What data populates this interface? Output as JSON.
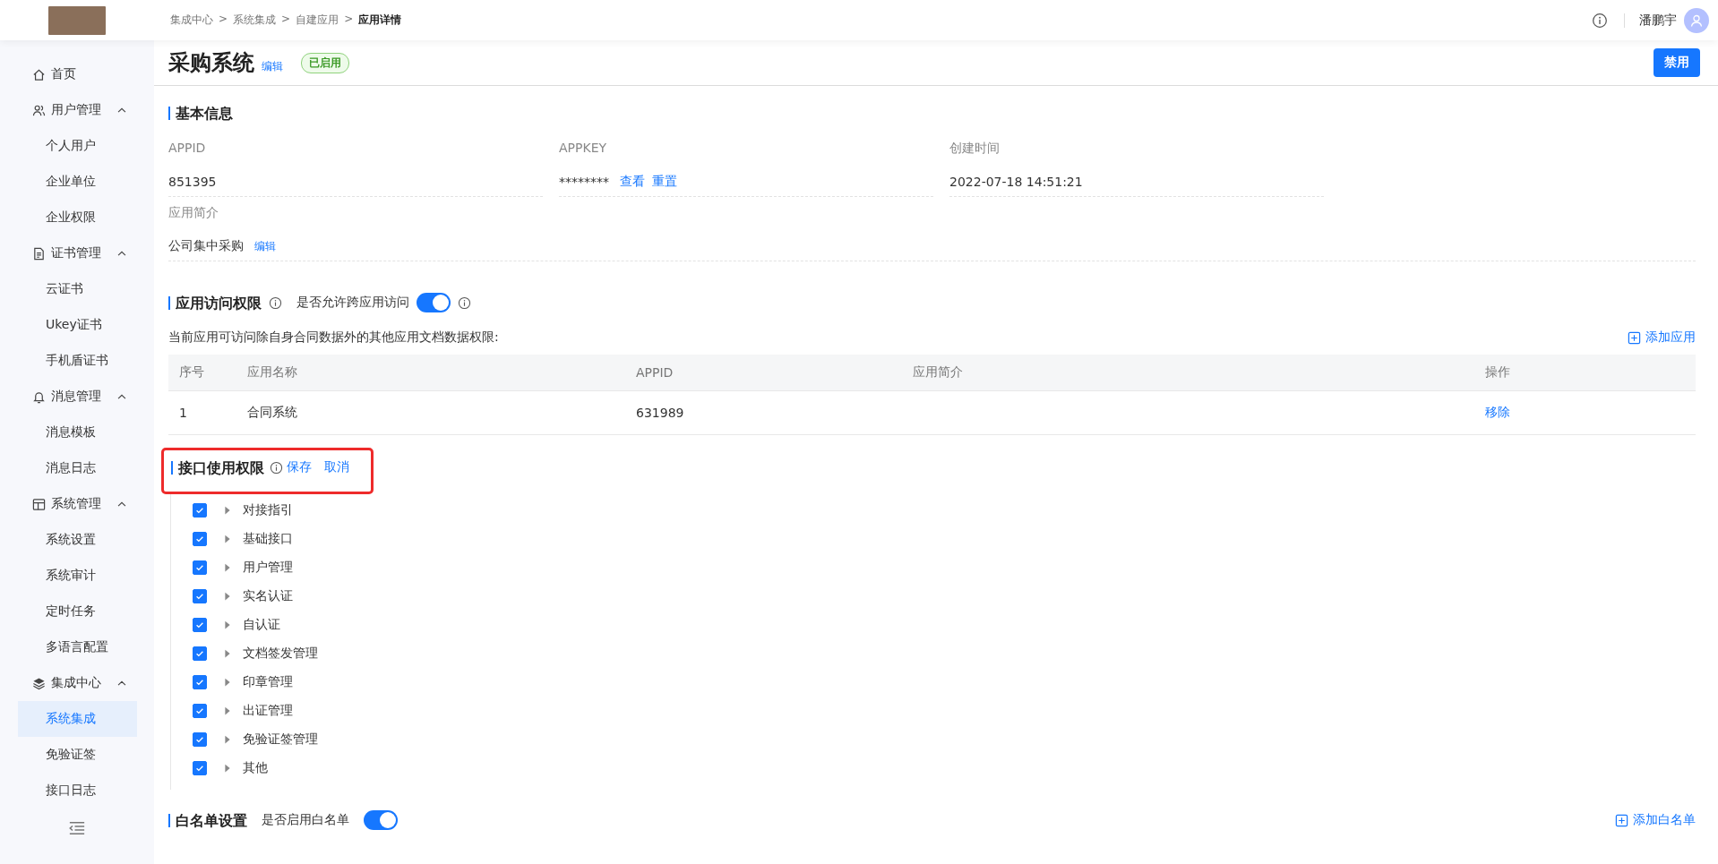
{
  "topbar": {
    "breadcrumb": [
      {
        "label": "集成中心",
        "separator": ">",
        "current": false
      },
      {
        "label": "系统集成",
        "separator": ">",
        "current": false
      },
      {
        "label": "自建应用",
        "separator": ">",
        "current": false
      },
      {
        "label": "应用详情",
        "current": true
      }
    ],
    "user": "潘鹏宇"
  },
  "sidebar": {
    "items": [
      {
        "label": "首页",
        "selected": false
      },
      {
        "label": "用户管理",
        "selected": false,
        "expanded": true,
        "children": [
          {
            "label": "个人用户",
            "selected": false
          },
          {
            "label": "企业单位",
            "selected": false
          },
          {
            "label": "企业权限",
            "selected": false
          }
        ]
      },
      {
        "label": "证书管理",
        "selected": false,
        "expanded": true,
        "children": [
          {
            "label": "云证书",
            "selected": false
          },
          {
            "label": "Ukey证书",
            "selected": false
          },
          {
            "label": "手机盾证书",
            "selected": false
          }
        ]
      },
      {
        "label": "消息管理",
        "selected": false,
        "expanded": true,
        "children": [
          {
            "label": "消息模板",
            "selected": false
          },
          {
            "label": "消息日志",
            "selected": false
          }
        ]
      },
      {
        "label": "系统管理",
        "selected": false,
        "expanded": true,
        "children": [
          {
            "label": "系统设置",
            "selected": false
          },
          {
            "label": "系统审计",
            "selected": false
          },
          {
            "label": "定时任务",
            "selected": false
          },
          {
            "label": "多语言配置",
            "selected": false
          }
        ]
      },
      {
        "label": "集成中心",
        "selected": false,
        "expanded": true,
        "children": [
          {
            "label": "系统集成",
            "selected": true
          },
          {
            "label": "免验证签",
            "selected": false
          },
          {
            "label": "接口日志",
            "selected": false
          }
        ]
      }
    ]
  },
  "page": {
    "title": "采购系统",
    "edit_link": "编辑",
    "status": "已启用",
    "disable_button": "禁用"
  },
  "basic_info": {
    "heading": "基本信息",
    "fields": [
      {
        "label": "APPID",
        "value": "851395"
      },
      {
        "label": "APPKEY",
        "value": "********",
        "actions": [
          "查看",
          "重置"
        ]
      },
      {
        "label": "创建时间",
        "value": "2022-07-18 14:51:21"
      },
      {
        "label": "应用简介",
        "value": "公司集中采购",
        "actions": [
          "编辑"
        ]
      }
    ]
  },
  "access": {
    "heading": "应用访问权限",
    "toggle_label": "是否允许跨应用访问",
    "toggle_on": true,
    "description": "当前应用可访问除自身合同数据外的其他应用文档数据权限:",
    "add_button": "添加应用",
    "table": {
      "columns": [
        "序号",
        "应用名称",
        "APPID",
        "应用简介",
        "操作"
      ],
      "rows": [
        {
          "index": "1",
          "name": "合同系统",
          "appid": "631989",
          "action": "移除"
        }
      ]
    }
  },
  "interface": {
    "heading": "接口使用权限",
    "save": "保存",
    "cancel": "取消",
    "highlighted": true,
    "items": [
      {
        "label": "对接指引",
        "checked": true,
        "expanded": false
      },
      {
        "label": "基础接口",
        "checked": true,
        "expanded": false
      },
      {
        "label": "用户管理",
        "checked": true,
        "expanded": false
      },
      {
        "label": "实名认证",
        "checked": true,
        "expanded": false
      },
      {
        "label": "自认证",
        "checked": true,
        "expanded": false
      },
      {
        "label": "文档签发管理",
        "checked": true,
        "expanded": false
      },
      {
        "label": "印章管理",
        "checked": true,
        "expanded": false
      },
      {
        "label": "出证管理",
        "checked": true,
        "expanded": false
      },
      {
        "label": "免验证签管理",
        "checked": true,
        "expanded": false
      },
      {
        "label": "其他",
        "checked": true,
        "expanded": false
      }
    ]
  },
  "whitelist": {
    "heading": "白名单设置",
    "toggle_label": "是否启用白名单",
    "toggle_on": true,
    "add_button": "添加白名单"
  }
}
